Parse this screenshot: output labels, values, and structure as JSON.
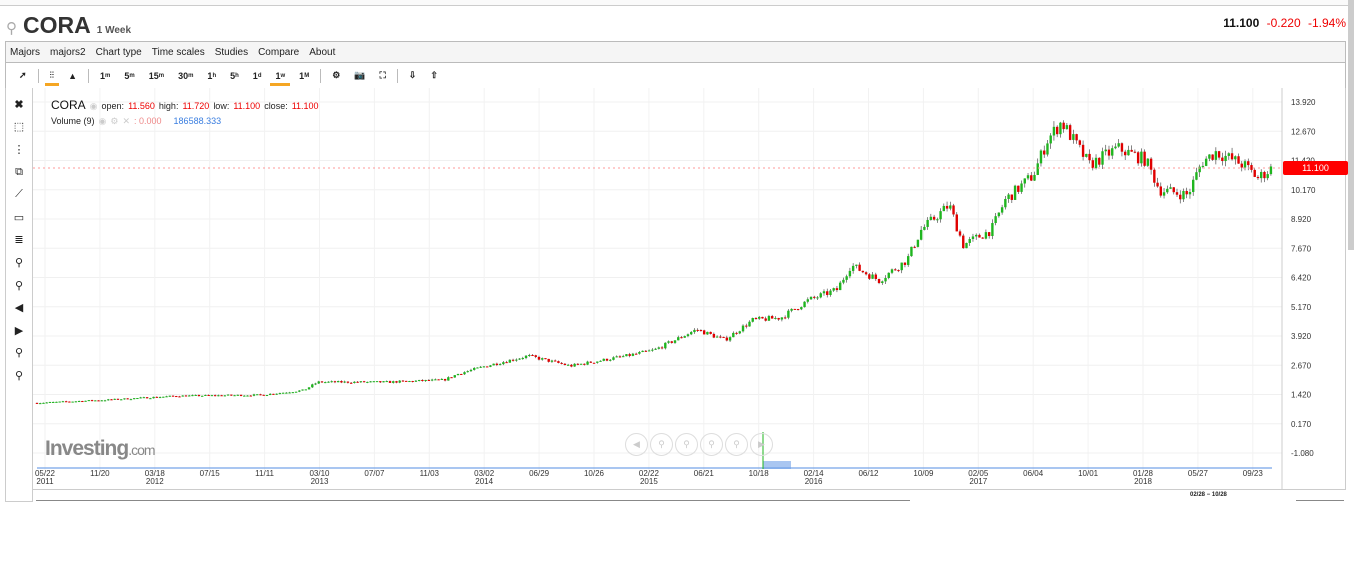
{
  "header": {
    "search_icon": "search-icon",
    "symbol": "CORA",
    "period": "1 Week",
    "last": "11.100",
    "change": "-0.220",
    "change_pct": "-1.94%"
  },
  "menu": [
    "Majors",
    "majors2",
    "Chart type",
    "Time scales",
    "Studies",
    "Compare",
    "About"
  ],
  "toolbar": {
    "intervals": [
      "1m",
      "5m",
      "15m",
      "30m",
      "1h",
      "5h",
      "1d",
      "1w",
      "1M"
    ],
    "selected_interval": "1w",
    "chart_type_selected": "candles"
  },
  "legend": {
    "symbol": "CORA",
    "open_label": "open:",
    "open": "11.560",
    "high_label": "high:",
    "high": "11.720",
    "low_label": "low:",
    "low": "11.100",
    "close_label": "close:",
    "close": "11.100",
    "volume_label": "Volume (9)",
    "volume_a": ": 0.000",
    "volume_b": "186588.333"
  },
  "logo": "Investing.com",
  "range_label": "02/28 − 10/28",
  "colors": {
    "up": "#1fb51f",
    "down": "#e00000",
    "accent": "#f5a623",
    "volume": "#6fa0e8"
  },
  "chart_data": {
    "type": "candlestick",
    "yticks": [
      "13.920",
      "12.670",
      "11.420",
      "10.170",
      "8.920",
      "7.670",
      "6.420",
      "5.170",
      "3.920",
      "2.670",
      "1.420",
      "0.170",
      "-1.080"
    ],
    "ylim": [
      -1.08,
      13.92
    ],
    "last_price": "11.100",
    "xticks": [
      [
        "05/22",
        "2011"
      ],
      [
        "11/20",
        ""
      ],
      [
        "03/18",
        "2012"
      ],
      [
        "07/15",
        ""
      ],
      [
        "11/11",
        ""
      ],
      [
        "03/10",
        "2013"
      ],
      [
        "07/07",
        ""
      ],
      [
        "11/03",
        ""
      ],
      [
        "03/02",
        "2014"
      ],
      [
        "06/29",
        ""
      ],
      [
        "10/26",
        ""
      ],
      [
        "02/22",
        "2015"
      ],
      [
        "06/21",
        ""
      ],
      [
        "10/18",
        ""
      ],
      [
        "02/14",
        "2016"
      ],
      [
        "06/12",
        ""
      ],
      [
        "10/09",
        ""
      ],
      [
        "02/05",
        "2017"
      ],
      [
        "06/04",
        ""
      ],
      [
        "10/01",
        ""
      ],
      [
        "01/28",
        "2018"
      ],
      [
        "05/27",
        ""
      ],
      [
        "09/23",
        ""
      ]
    ],
    "dates": [
      "2011-05",
      "2011-10",
      "2012-03",
      "2012-09",
      "2012-12",
      "2013-01",
      "2013-06",
      "2013-10",
      "2013-11",
      "2014-01",
      "2014-04",
      "2014-07",
      "2014-11",
      "2015-01",
      "2015-04",
      "2015-06",
      "2015-08",
      "2015-10",
      "2015-12",
      "2016-02",
      "2016-03",
      "2016-05",
      "2016-07",
      "2016-08",
      "2016-10",
      "2016-11",
      "2017-01",
      "2017-02",
      "2017-04",
      "2017-05",
      "2017-06",
      "2017-08",
      "2017-10",
      "2017-12",
      "2018-01",
      "2018-03",
      "2018-04",
      "2018-05",
      "2018-07",
      "2018-08",
      "2018-09"
    ],
    "close": [
      1.06,
      1.19,
      1.36,
      1.4,
      1.6,
      1.95,
      1.95,
      2.04,
      2.3,
      2.64,
      3.07,
      2.64,
      3.07,
      3.32,
      4.2,
      3.75,
      4.6,
      4.7,
      5.46,
      5.9,
      6.95,
      6.3,
      7.17,
      8.45,
      9.52,
      7.81,
      8.45,
      9.73,
      10.8,
      12.3,
      13.07,
      11.23,
      11.95,
      11.44,
      10.16,
      9.95,
      11.35,
      11.78,
      11.23,
      10.67,
      11.1
    ]
  }
}
